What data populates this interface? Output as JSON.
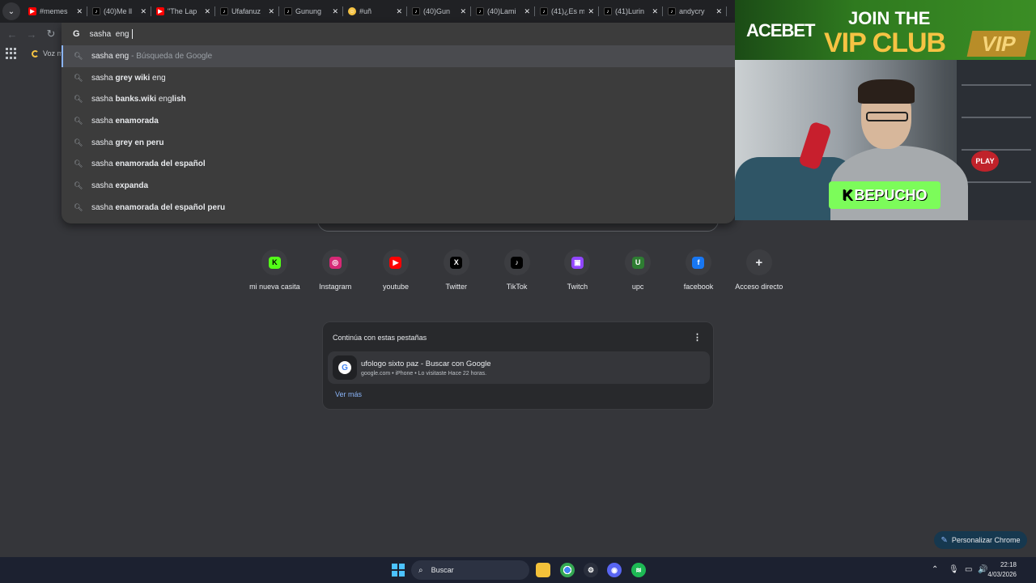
{
  "tabs": [
    {
      "title": "#memes",
      "icon": "youtube-icon"
    },
    {
      "title": "(40)Me ll",
      "icon": "tiktok-icon"
    },
    {
      "title": "\"The Lap",
      "icon": "youtube-icon"
    },
    {
      "title": "Ufafanuz",
      "icon": "tiktok-icon"
    },
    {
      "title": "Gunung",
      "icon": "tiktok-icon"
    },
    {
      "title": "#uñ",
      "icon": "emoji-icon"
    },
    {
      "title": "(40)Gun",
      "icon": "tiktok-icon"
    },
    {
      "title": "(40)Lami",
      "icon": "tiktok-icon"
    },
    {
      "title": "(41)¿Es m",
      "icon": "tiktok-icon"
    },
    {
      "title": "(41)Lurin",
      "icon": "tiktok-icon"
    },
    {
      "title": "andycry",
      "icon": "tiktok-icon"
    }
  ],
  "omnibox": {
    "query": "sasha  eng",
    "suggestions": [
      {
        "plain": "sasha eng",
        "bold": "",
        "tail": "",
        "sub": "- Búsqueda de Google"
      },
      {
        "plain": "sasha ",
        "bold": "grey wiki",
        "tail": " eng",
        "sub": ""
      },
      {
        "plain": "sasha ",
        "bold": "banks.wiki",
        "tail": " eng",
        "bold2": "lish",
        "sub": ""
      },
      {
        "plain": "sasha ",
        "bold": "enamorada",
        "tail": "",
        "sub": ""
      },
      {
        "plain": "sasha ",
        "bold": "grey en peru",
        "tail": "",
        "sub": ""
      },
      {
        "plain": "sasha ",
        "bold": "enamorada del español",
        "tail": "",
        "sub": ""
      },
      {
        "plain": "sasha ",
        "bold": "expanda",
        "tail": "",
        "sub": ""
      },
      {
        "plain": "sasha ",
        "bold": "enamorada del español peru",
        "tail": "",
        "sub": ""
      }
    ]
  },
  "bookmarks": {
    "item1": "Voz m"
  },
  "shortcuts": [
    {
      "label": "mi nueva casita",
      "glyph": "K",
      "color": "#53fc18",
      "text": "#000"
    },
    {
      "label": "Instagram",
      "glyph": "◎",
      "color": "#d62976",
      "text": "#fff"
    },
    {
      "label": "youtube",
      "glyph": "▶",
      "color": "#ff0000",
      "text": "#fff"
    },
    {
      "label": "Twitter",
      "glyph": "X",
      "color": "#000000",
      "text": "#fff"
    },
    {
      "label": "TikTok",
      "glyph": "♪",
      "color": "#000000",
      "text": "#fff"
    },
    {
      "label": "Twitch",
      "glyph": "▣",
      "color": "#9146ff",
      "text": "#fff"
    },
    {
      "label": "upc",
      "glyph": "U",
      "color": "#2e7d32",
      "text": "#fff"
    },
    {
      "label": "facebook",
      "glyph": "f",
      "color": "#1877f2",
      "text": "#fff"
    },
    {
      "label": "Acceso directo",
      "glyph": "+",
      "color": "transparent",
      "text": "#e8eaed"
    }
  ],
  "continue_card": {
    "title": "Continúa con estas pestañas",
    "item_title": "ufologo sixto paz - Buscar con Google",
    "item_meta": "google.com • iPhone • Lo visitaste Hace 22 horas.",
    "more": "Ver más"
  },
  "stream": {
    "brand": "ACEBET",
    "join": "JOIN THE",
    "vip_club": "VIP CLUB",
    "vip_badge": "VIP",
    "streamer": "BEPUCHO",
    "play": "PLAY"
  },
  "customize": "Personalizar Chrome",
  "taskbar": {
    "search": "Buscar",
    "time": "22:18",
    "date": "4/03/2026"
  }
}
